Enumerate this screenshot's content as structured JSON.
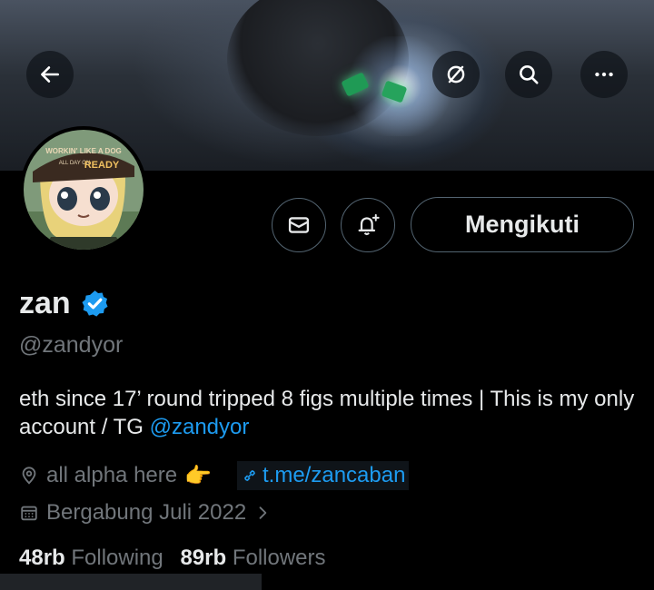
{
  "banner": {
    "back_icon": "arrow-left-icon",
    "grok_icon": "slashed-circle-icon",
    "search_icon": "search-icon",
    "more_icon": "more-dots-icon"
  },
  "actions": {
    "message_icon": "envelope-icon",
    "notify_icon": "bell-plus-icon",
    "follow_label": "Mengikuti"
  },
  "profile": {
    "name": "zan",
    "handle": "@zandyor",
    "verified_color": "#1d9bf0",
    "bio_text": "eth since 17’ round tripped 8 figs multiple times | This is my only account / TG ",
    "bio_link": "@zandyor",
    "location": "all alpha here",
    "location_emoji": "👉",
    "website": "t.me/zancaban",
    "joined": "Bergabung Juli 2022",
    "following_count": "48rb",
    "following_label": "Following",
    "followers_count": "89rb",
    "followers_label": "Followers",
    "avatar_hat_text_1": "WORKIN' LIKE A DOG",
    "avatar_hat_text_2": "ALL DAY ON",
    "avatar_hat_text_3": "READY"
  },
  "colors": {
    "background": "#000000",
    "text": "#e7e9ea",
    "muted": "#71767b",
    "accent": "#1d9bf0",
    "border": "#536471"
  }
}
